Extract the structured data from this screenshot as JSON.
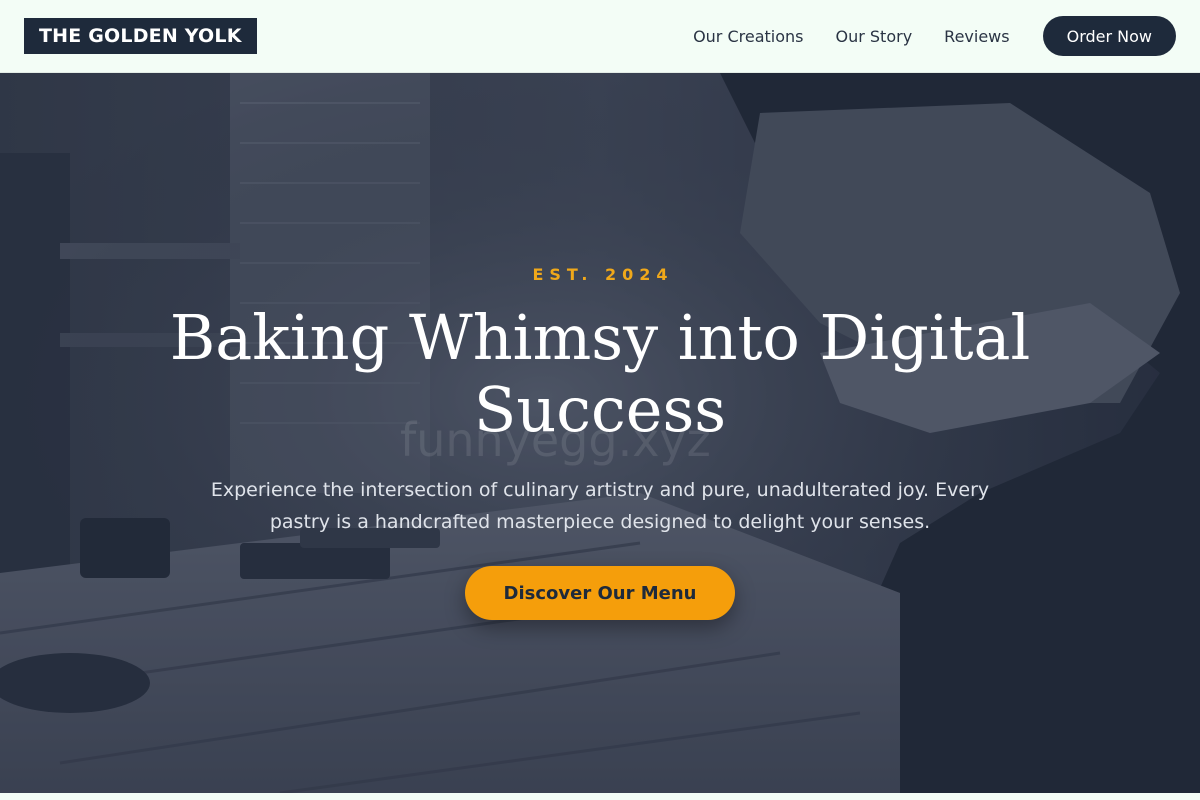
{
  "brand": {
    "logo_text": "THE GOLDEN YOLK"
  },
  "nav": {
    "links": [
      "Our Creations",
      "Our Story",
      "Reviews"
    ],
    "order_label": "Order Now"
  },
  "hero": {
    "eyebrow": "EST. 2024",
    "headline": "Baking Whimsy into Digital Success",
    "subtext": "Experience the intersection of culinary artistry and pure, unadulterated joy. Every pastry is a handcrafted masterpiece designed to delight your senses.",
    "cta_label": "Discover Our Menu",
    "watermark": "funnyegg.xyz",
    "background_image": "woodworker-at-workbench-photo"
  },
  "colors": {
    "nav_bg": "#f3fdf6",
    "brand_dark": "#1e2a3b",
    "accent": "#f59e0b",
    "eyebrow": "#f0a81a"
  }
}
